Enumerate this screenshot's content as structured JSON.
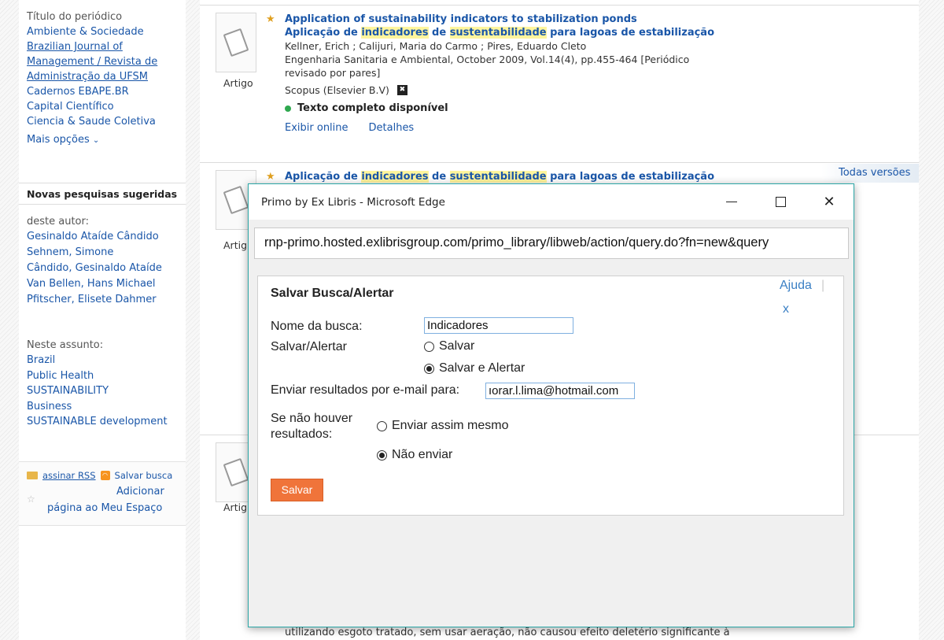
{
  "sidebar": {
    "journal_facet": {
      "title": "Título do periódico",
      "items": [
        "Ambiente & Sociedade",
        "Brazilian Journal of",
        "Management / Revista de",
        "Administração da UFSM",
        "Cadernos EBAPE.BR",
        "Capital Científico",
        "Ciencia & Saude Coletiva"
      ],
      "more_label": "Mais opções"
    },
    "suggested": {
      "heading": "Novas pesquisas sugeridas",
      "author_title": "deste autor:",
      "authors": [
        "Gesinaldo Ataíde Cândido",
        "Sehnem, Simone",
        "Cândido, Gesinaldo Ataíde",
        "Van Bellen, Hans Michael",
        "Pfitscher, Elisete Dahmer"
      ],
      "subject_title": "Neste assunto:",
      "subjects": [
        "Brazil",
        "Public Health",
        "SUSTAINABILITY",
        "Business",
        "SUSTAINABLE development"
      ]
    },
    "tools": {
      "rss_label": "assinar RSS",
      "save_search_label": "Salvar busca",
      "add_page_line1": "Adicionar",
      "add_page_line2": "página ao Meu Espaço"
    }
  },
  "results": {
    "items": [
      {
        "type_label": "Artigo",
        "title_en": "Application of sustainability indicators to stabilization ponds",
        "title_pt": {
          "pre": "Aplicação de ",
          "hl1": "indicadores",
          "mid": " de ",
          "hl2": "sustentabilidade",
          "post": " para lagoas de estabilização"
        },
        "authors": "Kellner, Erich ; Calijuri, Maria do Carmo ; Pires, Eduardo Cleto",
        "citation_line1": "Engenharia Sanitaria e Ambiental, October 2009, Vol.14(4), pp.455-464 [Periódico",
        "citation_line2": "revisado por pares]",
        "source": "Scopus (Elsevier B.V)",
        "availability": "Texto completo disponível",
        "link_online": "Exibir online",
        "link_details": "Detalhes"
      },
      {
        "type_label": "Artig",
        "title_pt": {
          "pre": "Aplicação de ",
          "hl1": "indicadores",
          "mid": " de ",
          "hl2": "sustentabilidade",
          "post": " para lagoas de estabilização"
        },
        "versions_label": "Todas versões"
      },
      {
        "type_label": "Artig"
      }
    ],
    "snippet_bottom": "utilizando esgoto tratado, sem usar aeração, não causou efeito deletério significante à"
  },
  "popup": {
    "window_title": "Primo by Ex Libris - Microsoft Edge",
    "url": "rnp-primo.hosted.exlibrisgroup.com/primo_library/libweb/action/query.do?fn=new&query",
    "form": {
      "title": "Salvar Busca/Alertar",
      "help": "Ajuda",
      "close": "x",
      "name_label": "Nome da busca:",
      "name_value": "Indicadores",
      "mode_label": "Salvar/Alertar",
      "mode_options": [
        "Salvar",
        "Salvar e Alertar"
      ],
      "mode_selected": "Salvar e Alertar",
      "email_label": "Enviar resultados por e-mail para:",
      "email_value": "ıorar.l.lima@hotmail.com",
      "noresult_label_1": "Se não houver",
      "noresult_label_2": "resultados:",
      "noresult_options": [
        "Enviar assim mesmo",
        "Não enviar"
      ],
      "noresult_selected": "Não enviar",
      "save_button": "Salvar"
    }
  }
}
